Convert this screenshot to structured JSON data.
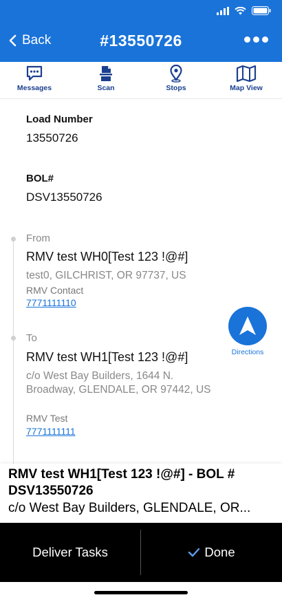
{
  "header": {
    "back_label": "Back",
    "title": "#13550726",
    "color": "#1a73d9"
  },
  "toolbar": {
    "items": [
      {
        "label": "Messages",
        "icon": "chat-icon"
      },
      {
        "label": "Scan",
        "icon": "scan-document-icon"
      },
      {
        "label": "Stops",
        "icon": "map-pin-icon"
      },
      {
        "label": "Map View",
        "icon": "folded-map-icon"
      }
    ]
  },
  "load": {
    "number_label": "Load Number",
    "number_value": "13550726",
    "bol_label": "BOL#",
    "bol_value": "DSV13550726"
  },
  "from": {
    "label": "From",
    "name": "RMV test WH0[Test 123 !@#]",
    "address": "test0, GILCHRIST, OR 97737, US",
    "contact": "RMV Contact",
    "phone": "7771111110"
  },
  "to": {
    "label": "To",
    "name": "RMV test WH1[Test 123 !@#]",
    "address": "c/o West Bay Builders, 1644 N. Broadway, GLENDALE, OR 97442, US",
    "contact": "RMV Test",
    "phone": "7771111111"
  },
  "directions": {
    "label": "Directions",
    "icon": "navigation-arrow-icon"
  },
  "summary": {
    "title": "RMV test WH1[Test 123 !@#] - BOL # DSV13550726",
    "address": "c/o West Bay Builders, GLENDALE, OR..."
  },
  "actions": {
    "deliver_label": "Deliver Tasks",
    "done_label": "Done",
    "done_icon": "checkmark-icon"
  }
}
